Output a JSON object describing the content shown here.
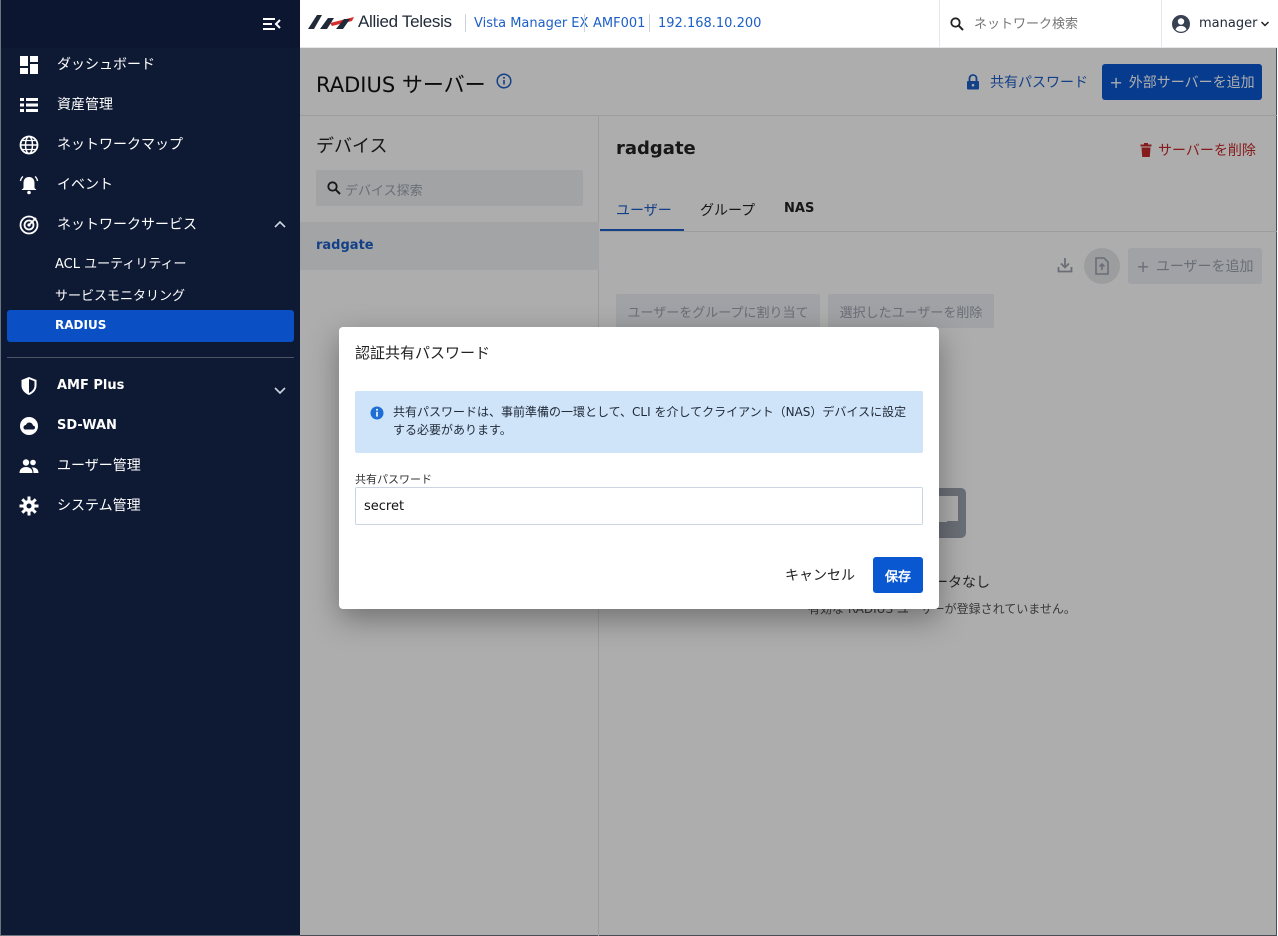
{
  "sidebar": {
    "items": [
      {
        "label": "ダッシュボード",
        "icon": "dashboard-icon"
      },
      {
        "label": "資産管理",
        "icon": "list-icon"
      },
      {
        "label": "ネットワークマップ",
        "icon": "globe-icon"
      },
      {
        "label": "イベント",
        "icon": "bell-icon"
      },
      {
        "label": "ネットワークサービス",
        "icon": "radar-icon"
      }
    ],
    "subitems": [
      "ACL ユーティリティー",
      "サービスモニタリング",
      "RADIUS"
    ],
    "items2": [
      {
        "label": "AMF Plus",
        "icon": "shield-icon"
      },
      {
        "label": "SD-WAN",
        "icon": "cloud-icon"
      },
      {
        "label": "ユーザー管理",
        "icon": "people-icon"
      },
      {
        "label": "システム管理",
        "icon": "gear-icon"
      }
    ]
  },
  "topbar": {
    "logo_text": "Allied Telesis",
    "breadcrumb": [
      "Vista Manager EX",
      "AMF001",
      "192.168.10.200"
    ],
    "search_placeholder": "ネットワーク検索",
    "user": "manager"
  },
  "page": {
    "title": "RADIUS サーバー",
    "shared_password_link": "共有パスワード",
    "add_external_server": "外部サーバーを追加"
  },
  "devices": {
    "title": "デバイス",
    "search_placeholder": "デバイス探索",
    "list": [
      "radgate"
    ]
  },
  "detail": {
    "title": "radgate",
    "delete_server": "サーバーを削除",
    "tabs": [
      "ユーザー",
      "グループ",
      "NAS"
    ],
    "add_user": "ユーザーを追加",
    "assign_group": "ユーザーをグループに割り当て",
    "delete_selected": "選択したユーザーを削除",
    "empty_title": "データなし",
    "empty_sub": "有効な RADIUS ユーザーが登録されていません。"
  },
  "modal": {
    "title": "認証共有パスワード",
    "info": "共有パスワードは、事前準備の一環として、CLI を介してクライアント（NAS）デバイスに設定する必要があります。",
    "field_label": "共有パスワード",
    "field_value": "secret",
    "cancel": "キャンセル",
    "save": "保存"
  },
  "colors": {
    "sidebar_bg": "#0e1a33",
    "active_item": "#0a4fc4",
    "primary": "#0a58d1",
    "link": "#1d5fc7",
    "danger": "#c62828",
    "info_bg": "#cfe4f8"
  }
}
